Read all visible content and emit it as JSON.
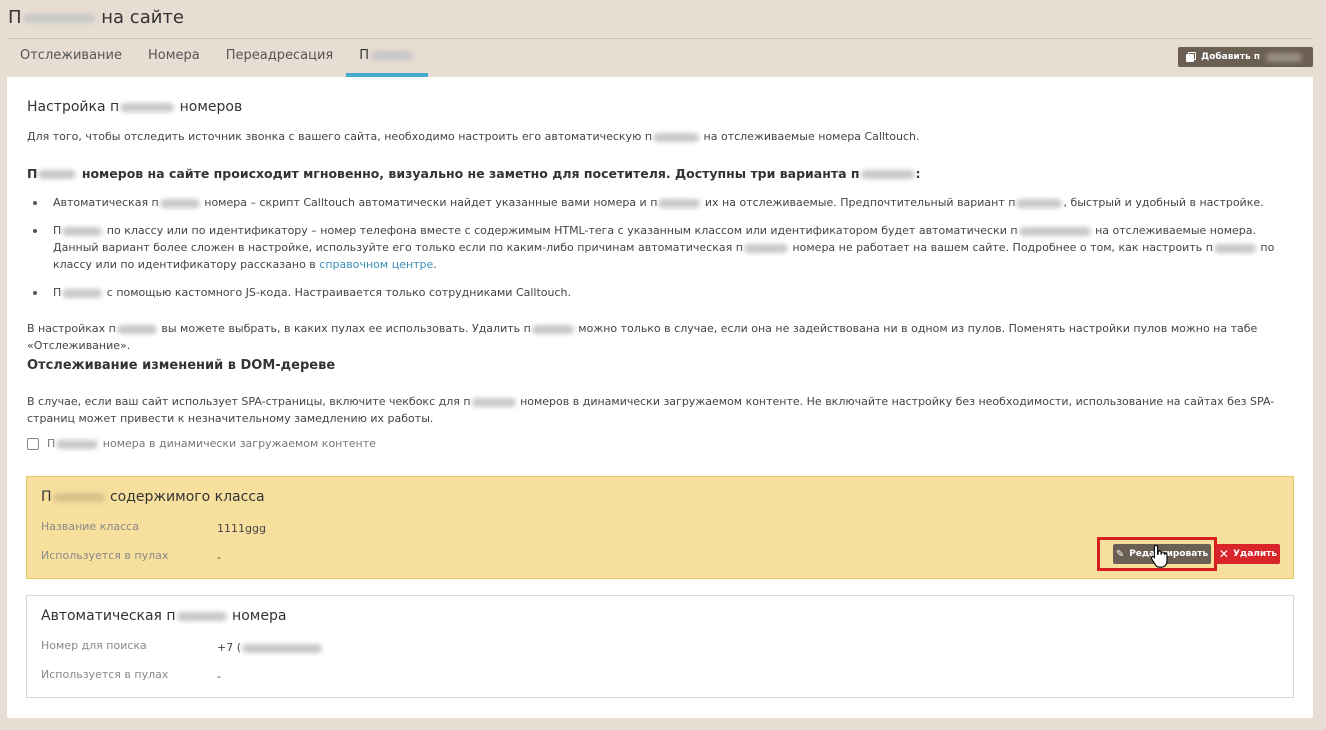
{
  "header": {
    "title_pre": "П",
    "title_post": "на сайте",
    "add_button_label": "Добавить п"
  },
  "tabs": [
    {
      "label": "Отслеживание"
    },
    {
      "label": "Номера"
    },
    {
      "label": "Переадресация"
    },
    {
      "label": "П"
    }
  ],
  "content": {
    "heading_pre": "Настройка п",
    "heading_post": "номеров",
    "intro_pre": "Для того, чтобы отследить источник звонка с вашего сайта, необходимо настроить его автоматическую п",
    "intro_post": "на отслеживаемые номера Calltouch.",
    "lead_pre": "П",
    "lead_mid": "номеров на сайте происходит мгновенно, визуально не заметно для посетителя. Доступны три варианта п",
    "lead_post": ":",
    "bullet1_a": "Автоматическая п",
    "bullet1_b": "номера – скрипт Calltouch автоматически найдет указанные вами номера и п",
    "bullet1_c": "их на отслеживаемые. Предпочтительный вариант п",
    "bullet1_d": ", быстрый и удобный в настройке.",
    "bullet2_a": "П",
    "bullet2_b": "по классу или по идентификатору – номер телефона вместе с содержимым HTML-тега с указанным классом или идентификатором будет автоматически п",
    "bullet2_c": "на отслеживаемые номера. Данный вариант более сложен в настройке, используйте его только если по каким-либо причинам автоматическая п",
    "bullet2_d": "номера не работает на вашем сайте. Подробнее о том, как настроить п",
    "bullet2_e": "по классу или по идентификатору рассказано в",
    "bullet2_link": "справочном центре",
    "bullet2_end": ".",
    "bullet3_a": "П",
    "bullet3_b": "с помощью кастомного JS-кода. Настраивается только сотрудниками Calltouch.",
    "settings_a": "В настройках п",
    "settings_b": "вы можете выбрать, в каких пулах ее использовать. Удалить п",
    "settings_c": "можно только в случае, если она не задействована ни в одном из пулов. Поменять настройки пулов можно на табе «Отслеживание».",
    "dom_heading": "Отслеживание изменений в DOM-дереве",
    "spa_a": "В случае, если ваш сайт использует SPA-страницы, включите чекбокс для п",
    "spa_b": "номеров в динамически загружаемом контенте. Не включайте настройку без необходимости, использование на сайтах без SPA-страниц может привести к незначительному замедлению их работы.",
    "checkbox_pre": "П",
    "checkbox_post": "номера в динамически загружаемом контенте"
  },
  "card_class": {
    "title_pre": "П",
    "title_post": "содержимого класса",
    "class_label": "Название класса",
    "class_value": "1111ggg",
    "pools_label": "Используется в пулах",
    "pools_value": "-",
    "edit_label": "Редактировать",
    "delete_label": "Удалить"
  },
  "card_auto": {
    "title_pre": "Автоматическая п",
    "title_post": "номера",
    "number_label": "Номер для поиска",
    "number_value": "+7 (",
    "pools_label": "Используется в пулах",
    "pools_value": "-"
  },
  "colors": {
    "accent_tab": "#43a9cc",
    "card_highlight": "#f7e09e",
    "danger": "#d9252a",
    "button_dark": "#6b5f54"
  }
}
